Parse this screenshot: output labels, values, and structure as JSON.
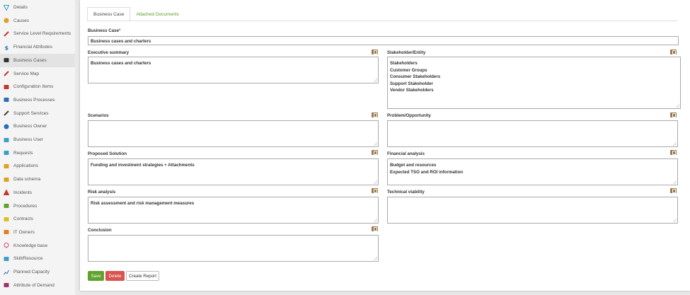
{
  "sidebar": {
    "items": [
      {
        "label": "Details",
        "icon": "filter-icon",
        "color": "#3aa0c8"
      },
      {
        "label": "Causes",
        "icon": "info-circle-icon",
        "color": "#e0a020"
      },
      {
        "label": "Service Level Requirements",
        "icon": "tools-icon",
        "color": "#c0392b"
      },
      {
        "label": "Financial Attributes",
        "icon": "dollar-icon",
        "color": "#2c6fb5"
      },
      {
        "label": "Business Cases",
        "icon": "briefcase-icon",
        "color": "#333333"
      },
      {
        "label": "Service Map",
        "icon": "pencil-icon",
        "color": "#c0392b"
      },
      {
        "label": "Configuration Items",
        "icon": "monitor-icon",
        "color": "#c0392b"
      },
      {
        "label": "Business Processes",
        "icon": "briefcase-icon",
        "color": "#2c6fb5"
      },
      {
        "label": "Support Services",
        "icon": "wrench-icon",
        "color": "#444444"
      },
      {
        "label": "Business Owner",
        "icon": "gear-icon",
        "color": "#2c6fb5"
      },
      {
        "label": "Business User",
        "icon": "shield-icon",
        "color": "#3aa0c8"
      },
      {
        "label": "Requests",
        "icon": "grid-icon",
        "color": "#3aa0c8"
      },
      {
        "label": "Applications",
        "icon": "apps-icon",
        "color": "#e0a020"
      },
      {
        "label": "Data schema",
        "icon": "list-icon",
        "color": "#e0a020"
      },
      {
        "label": "Incidents",
        "icon": "warning-icon",
        "color": "#c0392b"
      },
      {
        "label": "Procedures",
        "icon": "folder-icon",
        "color": "#5fa32e"
      },
      {
        "label": "Contracts",
        "icon": "folder-icon",
        "color": "#e0c020"
      },
      {
        "label": "IT Owners",
        "icon": "users-icon",
        "color": "#e08020"
      },
      {
        "label": "Knowledge base",
        "icon": "pin-icon",
        "color": "#e0407a"
      },
      {
        "label": "Skill/Resource",
        "icon": "id-card-icon",
        "color": "#3aa0c8"
      },
      {
        "label": "Planned Capacity",
        "icon": "chart-line-icon",
        "color": "#2c6fb5"
      },
      {
        "label": "Attribute of Demand",
        "icon": "table-icon",
        "color": "#a03070"
      }
    ],
    "active_index": 4
  },
  "tabs": [
    {
      "label": "Business Case",
      "active": true
    },
    {
      "label": "Attached Documents",
      "active": false
    }
  ],
  "form": {
    "business_case": {
      "label": "Business Case",
      "value": "Business cases and charters"
    },
    "executive_summary": {
      "label": "Executive summary",
      "lines": [
        "Business cases and charters"
      ]
    },
    "stakeholder": {
      "label": "Stakeholder/Entity",
      "lines": [
        "Stakeholders",
        "Customer Groups",
        "Consumer Stakeholders",
        "Support Stakeholder",
        "Vendor Stakeholders"
      ]
    },
    "scenarios": {
      "label": "Scenarios",
      "lines": []
    },
    "problem": {
      "label": "Problem/Opportunity",
      "lines": []
    },
    "proposed_solution": {
      "label": "Proposed Solution",
      "lines": [
        "Funding and investment strategies  + Attachments"
      ]
    },
    "financial_analysis": {
      "label": "Financial analysis",
      "lines": [
        "Budget and resources",
        "Expected TSO and ROI information"
      ]
    },
    "risk_analysis": {
      "label": "Risk analysis",
      "lines": [
        "Risk assessment and risk management measures"
      ]
    },
    "technical_viability": {
      "label": "Technical viability",
      "lines": []
    },
    "conclusion": {
      "label": "Conclusion",
      "lines": []
    }
  },
  "buttons": {
    "save": "Save",
    "delete": "Delete",
    "create_report": "Create Report"
  },
  "colors": {
    "accent_green": "#5fa32e",
    "danger_red": "#d9534f",
    "attach_icon": "#9a7b4f"
  }
}
